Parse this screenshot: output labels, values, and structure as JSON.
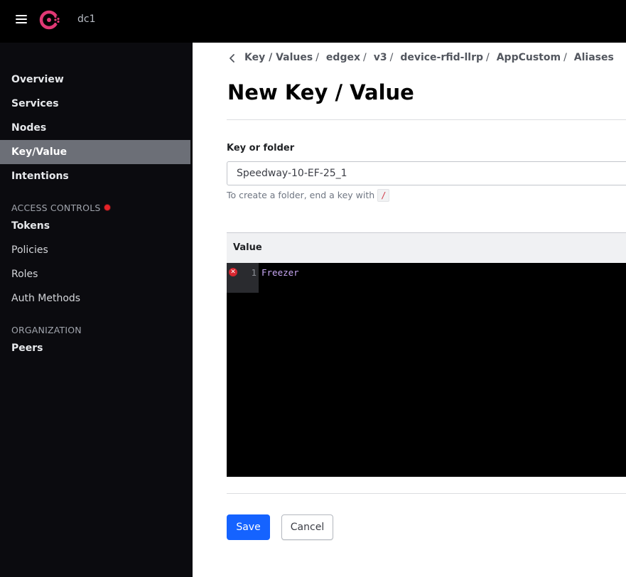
{
  "header": {
    "datacenter": "dc1",
    "colors": {
      "bar": "#000000",
      "brand": "#e03875"
    }
  },
  "sidebar": {
    "items": [
      {
        "label": "Overview"
      },
      {
        "label": "Services"
      },
      {
        "label": "Nodes"
      },
      {
        "label": "Key/Value",
        "active": true
      },
      {
        "label": "Intentions"
      }
    ],
    "access_controls": {
      "heading": "ACCESS CONTROLS",
      "status_color": "#e52228",
      "items": [
        {
          "label": "Tokens"
        },
        {
          "label": "Policies"
        },
        {
          "label": "Roles"
        },
        {
          "label": "Auth Methods"
        }
      ]
    },
    "organization": {
      "heading": "ORGANIZATION",
      "items": [
        {
          "label": "Peers"
        }
      ]
    }
  },
  "breadcrumb": [
    "Key / Values",
    "edgex",
    "v3",
    "device-rfid-llrp",
    "AppCustom",
    "Aliases"
  ],
  "page": {
    "title": "New Key / Value",
    "key_field": {
      "label": "Key or folder",
      "value": "Speedway-10-EF-25_1",
      "hint": "To create a folder, end a key with",
      "hint_code": "/"
    },
    "value_field": {
      "label": "Value",
      "lines": [
        {
          "number": "1",
          "text": "Freezer",
          "error": true
        }
      ]
    },
    "actions": {
      "save_label": "Save",
      "cancel_label": "Cancel",
      "primary_color": "#1563ff"
    }
  }
}
